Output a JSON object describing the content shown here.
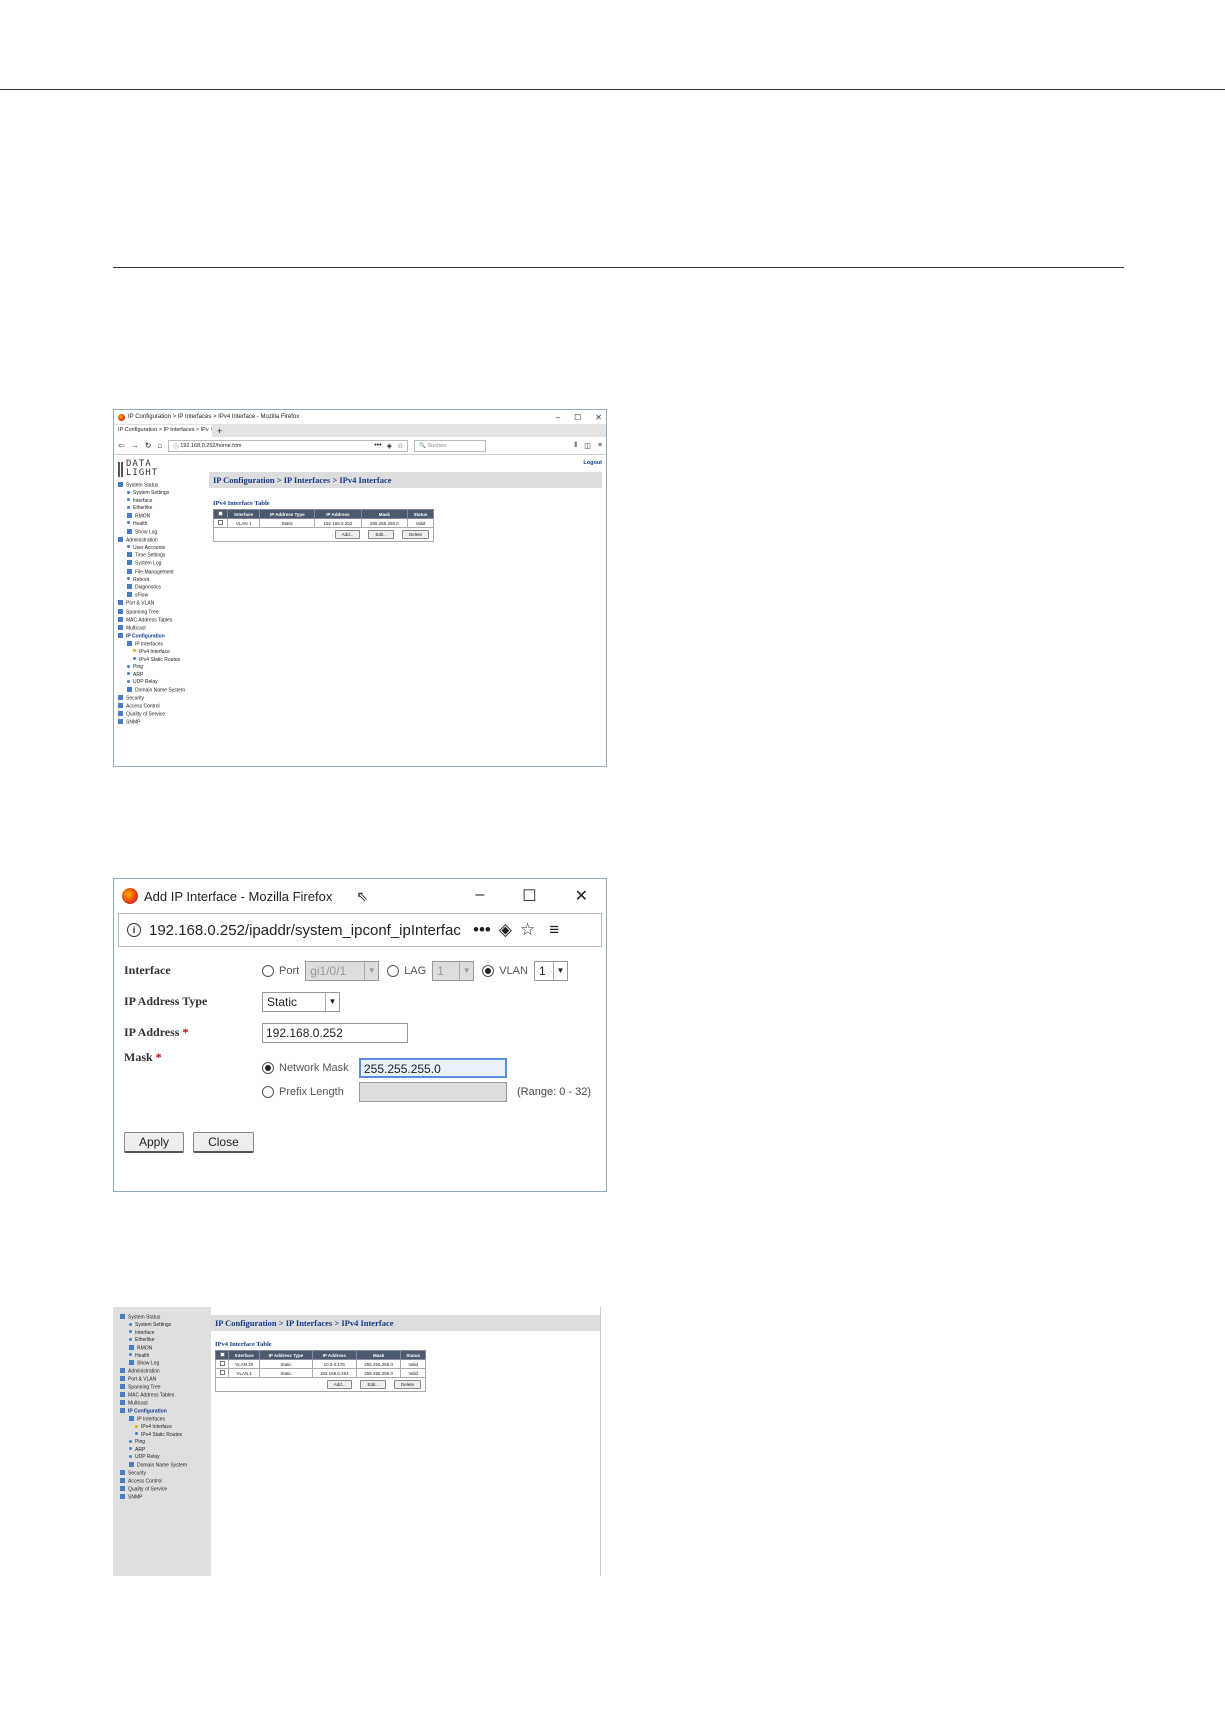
{
  "shot1": {
    "window_title": "IP Configuration > IP Interfaces > IPv4 Interface - Mozilla Firefox",
    "tab_label": "IP Configuration > IP Interfaces > IPv",
    "url": "192.168.0.252/home.htm",
    "search_placeholder": "Suchen",
    "logo_line1": "DATA",
    "logo_line2": "LIGHT",
    "logout": "Logout",
    "breadcrumb": "IP Configuration > IP Interfaces > IPv4 Interface",
    "table_title": "IPv4 Interface Table",
    "columns": [
      "Interface",
      "IP Address Type",
      "IP Address",
      "Mask",
      "Status"
    ],
    "rows": [
      {
        "interface": "VLAN 1",
        "type": "Static",
        "ip": "192.168.0.252",
        "mask": "255.255.255.0",
        "status": "Valid"
      }
    ],
    "buttons": {
      "add": "Add...",
      "edit": "Edit...",
      "delete": "Delete"
    },
    "nav": [
      {
        "label": "System Status",
        "level": 1,
        "kind": "folder"
      },
      {
        "label": "System Settings",
        "level": 2,
        "kind": "dot"
      },
      {
        "label": "Interface",
        "level": 2,
        "kind": "dot"
      },
      {
        "label": "Etherlike",
        "level": 2,
        "kind": "dot"
      },
      {
        "label": "RMON",
        "level": 2,
        "kind": "folder"
      },
      {
        "label": "Health",
        "level": 2,
        "kind": "dot"
      },
      {
        "label": "Show Log",
        "level": 2,
        "kind": "folder"
      },
      {
        "label": "Administration",
        "level": 1,
        "kind": "folder"
      },
      {
        "label": "User Accounts",
        "level": 2,
        "kind": "dot"
      },
      {
        "label": "Time Settings",
        "level": 2,
        "kind": "folder"
      },
      {
        "label": "System Log",
        "level": 2,
        "kind": "folder"
      },
      {
        "label": "File Management",
        "level": 2,
        "kind": "folder"
      },
      {
        "label": "Reboot",
        "level": 2,
        "kind": "dot"
      },
      {
        "label": "Diagnostics",
        "level": 2,
        "kind": "folder"
      },
      {
        "label": "sFlow",
        "level": 2,
        "kind": "folder"
      },
      {
        "label": "Port & VLAN",
        "level": 1,
        "kind": "folder"
      },
      {
        "label": "Spanning Tree",
        "level": 1,
        "kind": "folder"
      },
      {
        "label": "MAC Address Tables",
        "level": 1,
        "kind": "folder"
      },
      {
        "label": "Multicast",
        "level": 1,
        "kind": "folder"
      },
      {
        "label": "IP Configuration",
        "level": 1,
        "kind": "folder",
        "bold": true
      },
      {
        "label": "IP Interfaces",
        "level": 2,
        "kind": "folder"
      },
      {
        "label": "IPv4 Interface",
        "level": 3,
        "kind": "dot-y"
      },
      {
        "label": "IPv4 Static Routes",
        "level": 3,
        "kind": "dot"
      },
      {
        "label": "Ping",
        "level": 2,
        "kind": "dot"
      },
      {
        "label": "ARP",
        "level": 2,
        "kind": "dot"
      },
      {
        "label": "UDP Relay",
        "level": 2,
        "kind": "dot"
      },
      {
        "label": "Domain Name System",
        "level": 2,
        "kind": "folder"
      },
      {
        "label": "Security",
        "level": 1,
        "kind": "folder"
      },
      {
        "label": "Access Control",
        "level": 1,
        "kind": "folder"
      },
      {
        "label": "Quality of Service",
        "level": 1,
        "kind": "folder"
      },
      {
        "label": "SNMP",
        "level": 1,
        "kind": "folder"
      }
    ]
  },
  "shot2": {
    "window_title": "Add IP Interface - Mozilla Firefox",
    "url": "192.168.0.252/ipaddr/system_ipconf_ipInterfac",
    "interface_label": "Interface",
    "port_label": "Port",
    "port_value": "gi1/0/1",
    "lag_label": "LAG",
    "lag_value": "1",
    "vlan_label": "VLAN",
    "vlan_value": "1",
    "ip_type_label": "IP Address Type",
    "ip_type_value": "Static",
    "ip_label": "IP Address",
    "ip_value": "192.168.0.252",
    "mask_label": "Mask",
    "network_mask_label": "Network Mask",
    "network_mask_value": "255.255.255.0",
    "prefix_label": "Prefix Length",
    "range": "(Range: 0 - 32)",
    "apply": "Apply",
    "close": "Close"
  },
  "shot3": {
    "breadcrumb": "IP Configuration > IP Interfaces > IPv4 Interface",
    "table_title": "IPv4 Interface Table",
    "columns": [
      "Interface",
      "IP Address Type",
      "IP Address",
      "Mask",
      "Status"
    ],
    "rows": [
      {
        "interface": "VLAN 20",
        "type": "Static",
        "ip": "10.0.0.175",
        "mask": "255.255.255.0",
        "status": "Valid"
      },
      {
        "interface": "VLAN 1",
        "type": "Static",
        "ip": "192.168.0.254",
        "mask": "255.255.255.0",
        "status": "Valid"
      }
    ],
    "buttons": {
      "add": "Add...",
      "edit": "Edit...",
      "delete": "Delete"
    },
    "nav": [
      {
        "label": "System Status",
        "level": 1,
        "kind": "folder"
      },
      {
        "label": "System Settings",
        "level": 2,
        "kind": "dot"
      },
      {
        "label": "Interface",
        "level": 2,
        "kind": "dot"
      },
      {
        "label": "Etherlike",
        "level": 2,
        "kind": "dot"
      },
      {
        "label": "RMON",
        "level": 2,
        "kind": "folder"
      },
      {
        "label": "Health",
        "level": 2,
        "kind": "dot"
      },
      {
        "label": "Show Log",
        "level": 2,
        "kind": "folder"
      },
      {
        "label": "Administration",
        "level": 1,
        "kind": "folder"
      },
      {
        "label": "Port & VLAN",
        "level": 1,
        "kind": "folder"
      },
      {
        "label": "Spanning Tree",
        "level": 1,
        "kind": "folder"
      },
      {
        "label": "MAC Address Tables",
        "level": 1,
        "kind": "folder"
      },
      {
        "label": "Multicast",
        "level": 1,
        "kind": "folder"
      },
      {
        "label": "IP Configuration",
        "level": 1,
        "kind": "folder",
        "bold": true
      },
      {
        "label": "IP Interfaces",
        "level": 2,
        "kind": "folder"
      },
      {
        "label": "IPv4 Interface",
        "level": 3,
        "kind": "dot-y"
      },
      {
        "label": "IPv4 Static Routes",
        "level": 3,
        "kind": "dot"
      },
      {
        "label": "Ping",
        "level": 2,
        "kind": "dot"
      },
      {
        "label": "ARP",
        "level": 2,
        "kind": "dot"
      },
      {
        "label": "UDP Relay",
        "level": 2,
        "kind": "dot"
      },
      {
        "label": "Domain Name System",
        "level": 2,
        "kind": "folder"
      },
      {
        "label": "Security",
        "level": 1,
        "kind": "folder"
      },
      {
        "label": "Access Control",
        "level": 1,
        "kind": "folder"
      },
      {
        "label": "Quality of Service",
        "level": 1,
        "kind": "folder"
      },
      {
        "label": "SNMP",
        "level": 1,
        "kind": "folder"
      }
    ]
  }
}
